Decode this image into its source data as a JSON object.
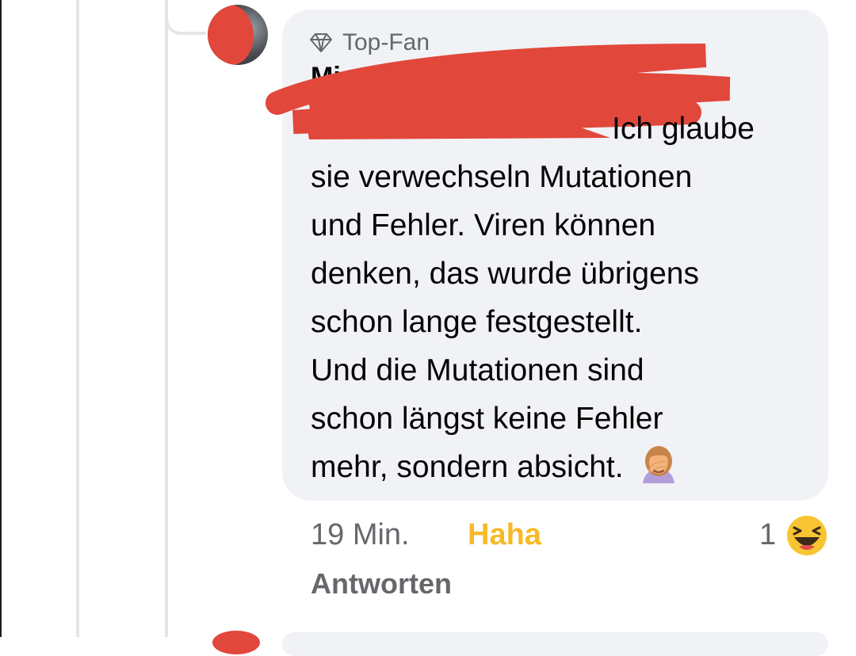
{
  "comment": {
    "badge_label": "Top-Fan",
    "badge_icon": "diamond-icon",
    "author_name": "Mi",
    "mention": "...",
    "text_lines": [
      "Ich glaube",
      "sie verwechseln Mutationen",
      "und Fehler. Viren können",
      "denken, das wurde übrigens",
      "schon lange festgestellt.",
      "Und die Mutationen sind",
      "schon längst keine Fehler",
      "mehr, sondern absicht."
    ],
    "inline_emoji": "woman-facepalming-icon",
    "timestamp": "19 Min.",
    "reaction_link": "Haha",
    "reaction_count": "1",
    "reaction_emoji": "laughing-face-icon",
    "reply_label": "Antworten"
  },
  "colors": {
    "bubble": "#f0f2f5",
    "haha": "#f7b928",
    "meta_text": "#65676b",
    "mention": "#1877f2",
    "redaction": "#e2473b"
  }
}
